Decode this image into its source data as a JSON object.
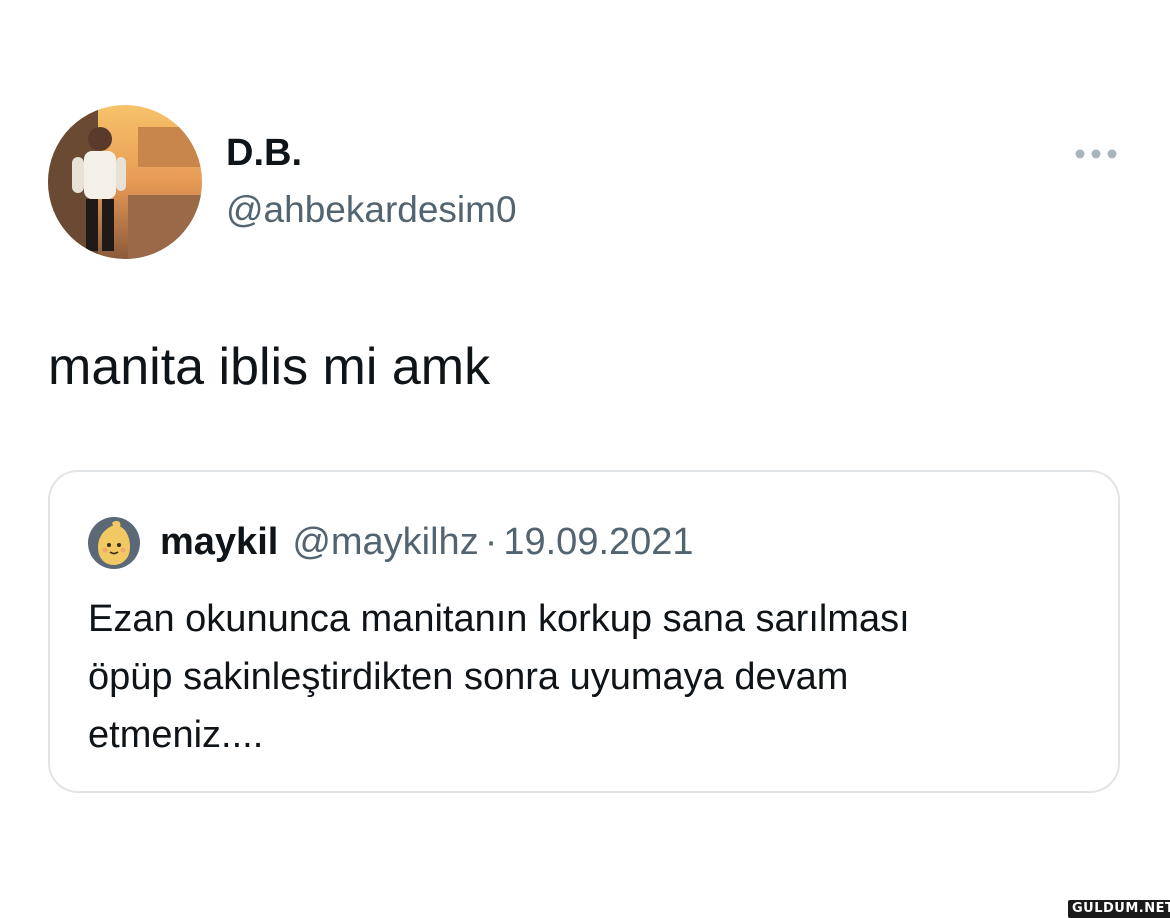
{
  "tweet": {
    "author": {
      "display_name": "D.B.",
      "handle": "@ahbekardesim0",
      "avatar": "profile-photo"
    },
    "more_icon": "more-horizontal-icon",
    "text": "manita iblis mi amk",
    "quote": {
      "author": {
        "display_name": "maykil",
        "handle": "@maykilhz",
        "separator": "·",
        "date": "19.09.2021",
        "avatar": "cartoon-avatar"
      },
      "text_lines": [
        "Ezan okununca manitanın korkup sana sarılması",
        "öpüp sakinleştirdikten sonra uyumaya devam",
        "etmeniz...."
      ]
    }
  },
  "watermark": {
    "text": "GULDUM.NET"
  },
  "colors": {
    "text_primary": "#0f1419",
    "text_secondary": "#536471",
    "border": "#e1e5e8",
    "background": "#ffffff"
  }
}
